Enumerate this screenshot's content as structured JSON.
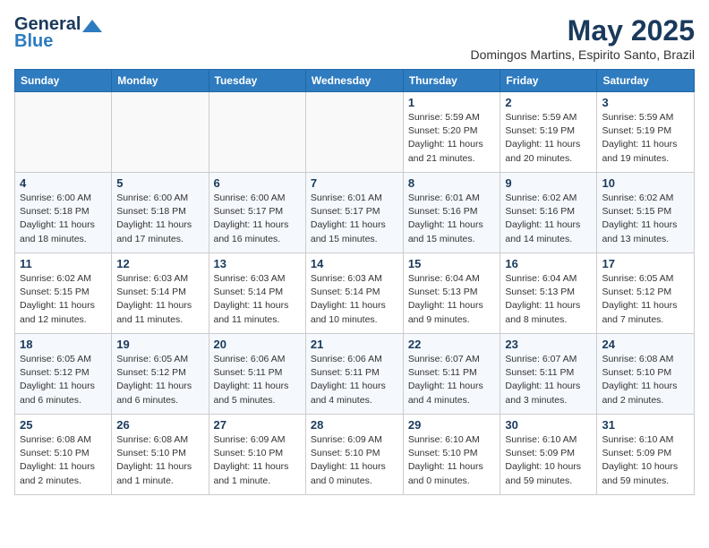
{
  "header": {
    "logo_line1": "General",
    "logo_line2": "Blue",
    "month_title": "May 2025",
    "subtitle": "Domingos Martins, Espirito Santo, Brazil"
  },
  "weekdays": [
    "Sunday",
    "Monday",
    "Tuesday",
    "Wednesday",
    "Thursday",
    "Friday",
    "Saturday"
  ],
  "weeks": [
    [
      {
        "day": "",
        "info": ""
      },
      {
        "day": "",
        "info": ""
      },
      {
        "day": "",
        "info": ""
      },
      {
        "day": "",
        "info": ""
      },
      {
        "day": "1",
        "info": "Sunrise: 5:59 AM\nSunset: 5:20 PM\nDaylight: 11 hours\nand 21 minutes."
      },
      {
        "day": "2",
        "info": "Sunrise: 5:59 AM\nSunset: 5:19 PM\nDaylight: 11 hours\nand 20 minutes."
      },
      {
        "day": "3",
        "info": "Sunrise: 5:59 AM\nSunset: 5:19 PM\nDaylight: 11 hours\nand 19 minutes."
      }
    ],
    [
      {
        "day": "4",
        "info": "Sunrise: 6:00 AM\nSunset: 5:18 PM\nDaylight: 11 hours\nand 18 minutes."
      },
      {
        "day": "5",
        "info": "Sunrise: 6:00 AM\nSunset: 5:18 PM\nDaylight: 11 hours\nand 17 minutes."
      },
      {
        "day": "6",
        "info": "Sunrise: 6:00 AM\nSunset: 5:17 PM\nDaylight: 11 hours\nand 16 minutes."
      },
      {
        "day": "7",
        "info": "Sunrise: 6:01 AM\nSunset: 5:17 PM\nDaylight: 11 hours\nand 15 minutes."
      },
      {
        "day": "8",
        "info": "Sunrise: 6:01 AM\nSunset: 5:16 PM\nDaylight: 11 hours\nand 15 minutes."
      },
      {
        "day": "9",
        "info": "Sunrise: 6:02 AM\nSunset: 5:16 PM\nDaylight: 11 hours\nand 14 minutes."
      },
      {
        "day": "10",
        "info": "Sunrise: 6:02 AM\nSunset: 5:15 PM\nDaylight: 11 hours\nand 13 minutes."
      }
    ],
    [
      {
        "day": "11",
        "info": "Sunrise: 6:02 AM\nSunset: 5:15 PM\nDaylight: 11 hours\nand 12 minutes."
      },
      {
        "day": "12",
        "info": "Sunrise: 6:03 AM\nSunset: 5:14 PM\nDaylight: 11 hours\nand 11 minutes."
      },
      {
        "day": "13",
        "info": "Sunrise: 6:03 AM\nSunset: 5:14 PM\nDaylight: 11 hours\nand 11 minutes."
      },
      {
        "day": "14",
        "info": "Sunrise: 6:03 AM\nSunset: 5:14 PM\nDaylight: 11 hours\nand 10 minutes."
      },
      {
        "day": "15",
        "info": "Sunrise: 6:04 AM\nSunset: 5:13 PM\nDaylight: 11 hours\nand 9 minutes."
      },
      {
        "day": "16",
        "info": "Sunrise: 6:04 AM\nSunset: 5:13 PM\nDaylight: 11 hours\nand 8 minutes."
      },
      {
        "day": "17",
        "info": "Sunrise: 6:05 AM\nSunset: 5:12 PM\nDaylight: 11 hours\nand 7 minutes."
      }
    ],
    [
      {
        "day": "18",
        "info": "Sunrise: 6:05 AM\nSunset: 5:12 PM\nDaylight: 11 hours\nand 6 minutes."
      },
      {
        "day": "19",
        "info": "Sunrise: 6:05 AM\nSunset: 5:12 PM\nDaylight: 11 hours\nand 6 minutes."
      },
      {
        "day": "20",
        "info": "Sunrise: 6:06 AM\nSunset: 5:11 PM\nDaylight: 11 hours\nand 5 minutes."
      },
      {
        "day": "21",
        "info": "Sunrise: 6:06 AM\nSunset: 5:11 PM\nDaylight: 11 hours\nand 4 minutes."
      },
      {
        "day": "22",
        "info": "Sunrise: 6:07 AM\nSunset: 5:11 PM\nDaylight: 11 hours\nand 4 minutes."
      },
      {
        "day": "23",
        "info": "Sunrise: 6:07 AM\nSunset: 5:11 PM\nDaylight: 11 hours\nand 3 minutes."
      },
      {
        "day": "24",
        "info": "Sunrise: 6:08 AM\nSunset: 5:10 PM\nDaylight: 11 hours\nand 2 minutes."
      }
    ],
    [
      {
        "day": "25",
        "info": "Sunrise: 6:08 AM\nSunset: 5:10 PM\nDaylight: 11 hours\nand 2 minutes."
      },
      {
        "day": "26",
        "info": "Sunrise: 6:08 AM\nSunset: 5:10 PM\nDaylight: 11 hours\nand 1 minute."
      },
      {
        "day": "27",
        "info": "Sunrise: 6:09 AM\nSunset: 5:10 PM\nDaylight: 11 hours\nand 1 minute."
      },
      {
        "day": "28",
        "info": "Sunrise: 6:09 AM\nSunset: 5:10 PM\nDaylight: 11 hours\nand 0 minutes."
      },
      {
        "day": "29",
        "info": "Sunrise: 6:10 AM\nSunset: 5:10 PM\nDaylight: 11 hours\nand 0 minutes."
      },
      {
        "day": "30",
        "info": "Sunrise: 6:10 AM\nSunset: 5:09 PM\nDaylight: 10 hours\nand 59 minutes."
      },
      {
        "day": "31",
        "info": "Sunrise: 6:10 AM\nSunset: 5:09 PM\nDaylight: 10 hours\nand 59 minutes."
      }
    ]
  ]
}
